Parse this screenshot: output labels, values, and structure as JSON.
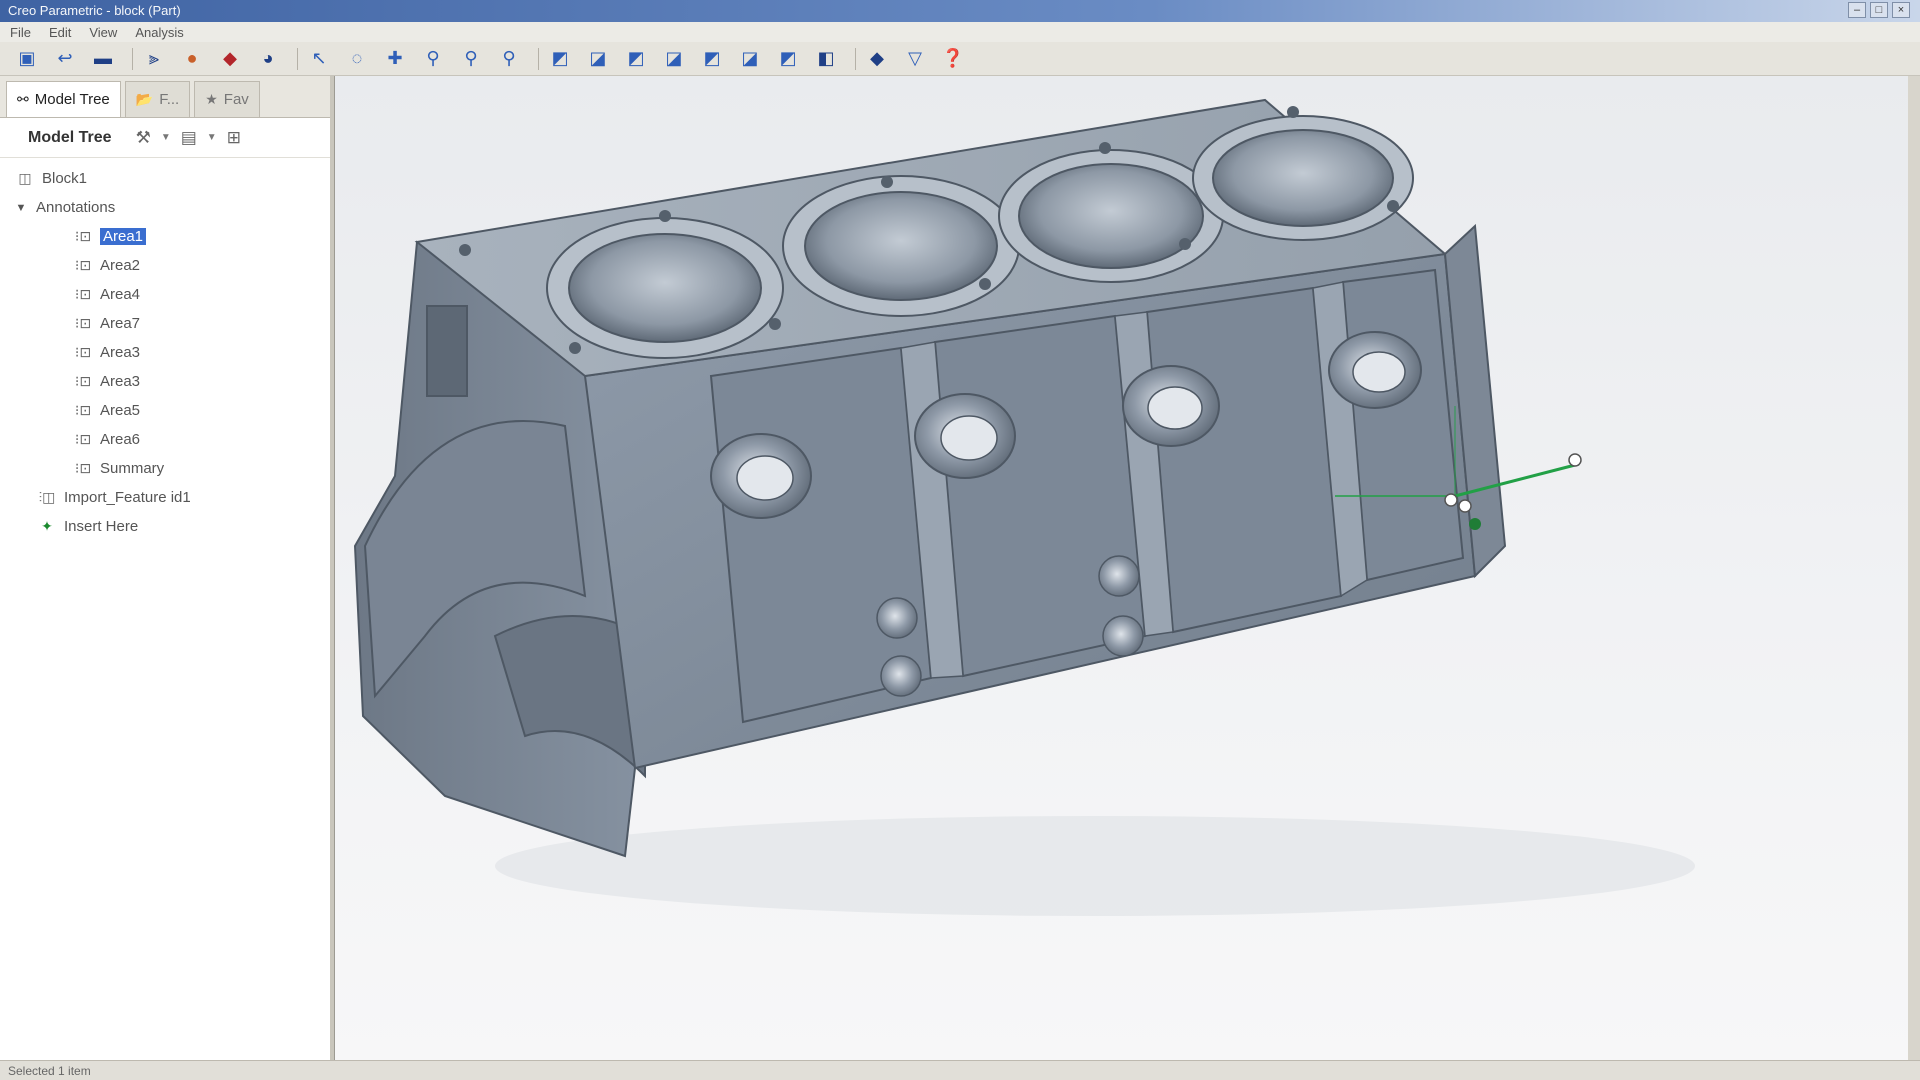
{
  "window": {
    "title": "Creo Parametric - block (Part)"
  },
  "menubar": {
    "items": [
      "File",
      "Edit",
      "View",
      "Analysis"
    ]
  },
  "toolbar": {
    "icons": [
      "new-icon",
      "open-icon",
      "save-icon",
      "repaint-icon",
      "spin-center-icon",
      "orient-icon",
      "shading-icon",
      "select-icon",
      "zoom-in-icon",
      "zoom-out-icon",
      "refit-icon",
      "pan-icon",
      "saved-views-icon",
      "datum-planes-icon",
      "datum-axes-icon",
      "datum-points-icon",
      "csys-icon",
      "annotation-icon",
      "layer-icon",
      "filter-icon",
      "help-icon"
    ]
  },
  "leftpanel": {
    "tabs": [
      {
        "label": "Model Tree",
        "icon": "model-tree-icon",
        "active": true
      },
      {
        "label": "F...",
        "icon": "folder-icon",
        "active": false
      },
      {
        "label": "Fav",
        "icon": "favorites-icon",
        "active": false
      }
    ],
    "tree_toolbar_label": "Model Tree",
    "tree": {
      "root": "Block1",
      "annotations_label": "Annotations",
      "areas": [
        "Area1",
        "Area2",
        "Area4",
        "Area7",
        "Area3",
        "Area3",
        "Area5",
        "Area6",
        "Summary"
      ],
      "selected_index": 0,
      "import_feature": "Import_Feature id1",
      "insert_here": "Insert Here"
    }
  },
  "statusbar": {
    "text": "Selected 1 item"
  },
  "colors": {
    "part_face": "#8a96a3",
    "part_top": "#a9b2bd",
    "part_dark": "#646f7c",
    "selection": "#3a6ed0",
    "csys_green": "#22a046"
  }
}
